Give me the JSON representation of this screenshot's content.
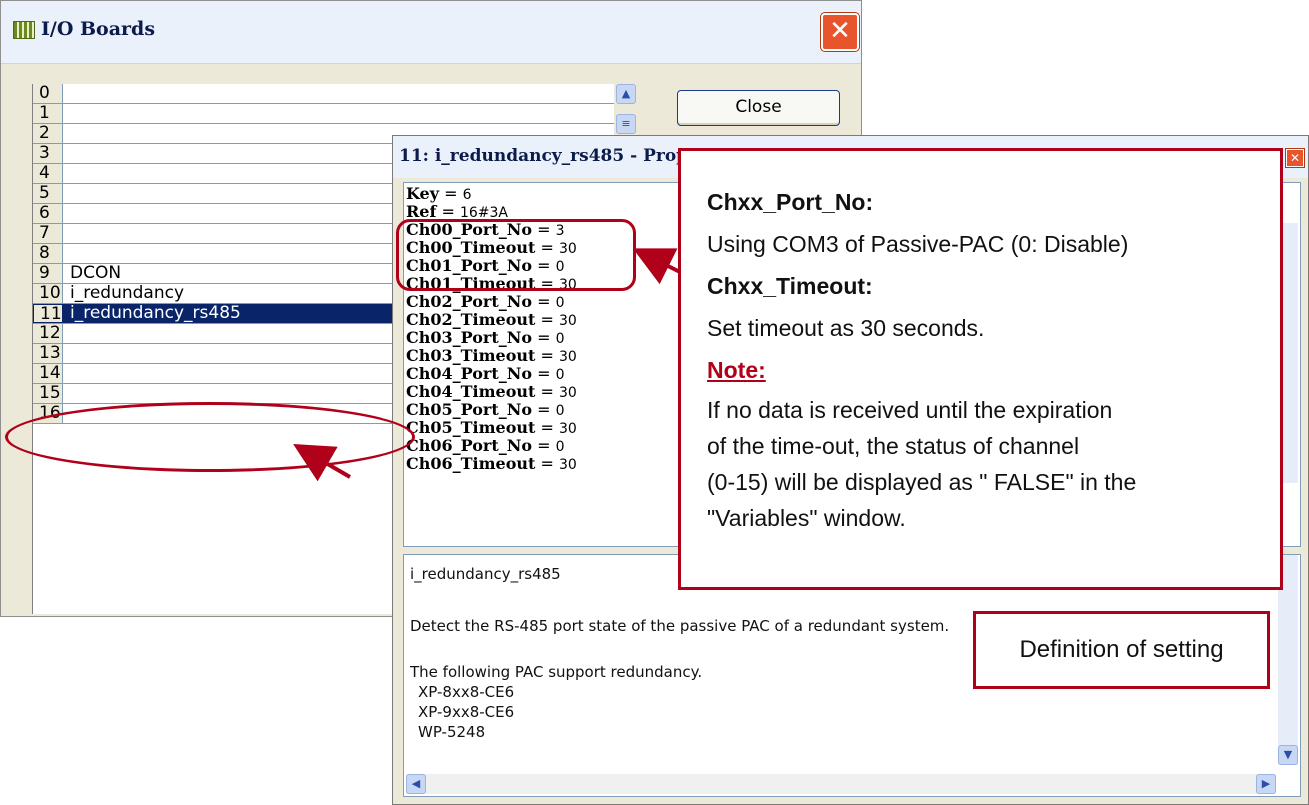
{
  "io_window": {
    "title": "I/O Boards",
    "close_button": "Close",
    "rows": [
      {
        "num": "0",
        "name": ""
      },
      {
        "num": "1",
        "name": ""
      },
      {
        "num": "2",
        "name": ""
      },
      {
        "num": "3",
        "name": ""
      },
      {
        "num": "4",
        "name": ""
      },
      {
        "num": "5",
        "name": ""
      },
      {
        "num": "6",
        "name": ""
      },
      {
        "num": "7",
        "name": ""
      },
      {
        "num": "8",
        "name": ""
      },
      {
        "num": "9",
        "name": "DCON"
      },
      {
        "num": "10",
        "name": "i_redundancy"
      },
      {
        "num": "11",
        "name": "i_redundancy_rs485"
      },
      {
        "num": "12",
        "name": ""
      },
      {
        "num": "13",
        "name": ""
      },
      {
        "num": "14",
        "name": ""
      },
      {
        "num": "15",
        "name": ""
      },
      {
        "num": "16",
        "name": ""
      }
    ],
    "selected_row": "11"
  },
  "properties_window": {
    "title": "11: i_redundancy_rs485 - Properties",
    "params": [
      {
        "key": "Key",
        "value": "6"
      },
      {
        "key": "Ref",
        "value": "16#3A"
      },
      {
        "key": "Ch00_Port_No",
        "value": "3"
      },
      {
        "key": "Ch00_Timeout",
        "value": "30"
      },
      {
        "key": "Ch01_Port_No",
        "value": "0"
      },
      {
        "key": "Ch01_Timeout",
        "value": "30"
      },
      {
        "key": "Ch02_Port_No",
        "value": "0"
      },
      {
        "key": "Ch02_Timeout",
        "value": "30"
      },
      {
        "key": "Ch03_Port_No",
        "value": "0"
      },
      {
        "key": "Ch03_Timeout",
        "value": "30"
      },
      {
        "key": "Ch04_Port_No",
        "value": "0"
      },
      {
        "key": "Ch04_Timeout",
        "value": "30"
      },
      {
        "key": "Ch05_Port_No",
        "value": "0"
      },
      {
        "key": "Ch05_Timeout",
        "value": "30"
      },
      {
        "key": "Ch06_Port_No",
        "value": "0"
      },
      {
        "key": "Ch06_Timeout",
        "value": "30"
      }
    ],
    "description": {
      "name": "i_redundancy_rs485",
      "summary": "Detect the RS-485 port state of the passive PAC of a redundant system.",
      "support_heading": "The following PAC support redundancy.",
      "models": [
        "XP-8xx8-CE6",
        "XP-9xx8-CE6",
        "WP-5248"
      ]
    }
  },
  "annotations": {
    "port_heading": "Chxx_Port_No:",
    "port_text": "Using COM3 of Passive-PAC (0: Disable)",
    "timeout_heading": "Chxx_Timeout:",
    "timeout_text": "Set timeout as 30 seconds.",
    "note_heading": "Note:",
    "note_lines": [
      "If no data is received until the expiration",
      "of the time-out, the status of channel",
      "(0-15) will be displayed as \" FALSE\" in the",
      "\"Variables\" window."
    ],
    "definition_label": "Definition of setting",
    "accent_color": "#b0001a"
  }
}
